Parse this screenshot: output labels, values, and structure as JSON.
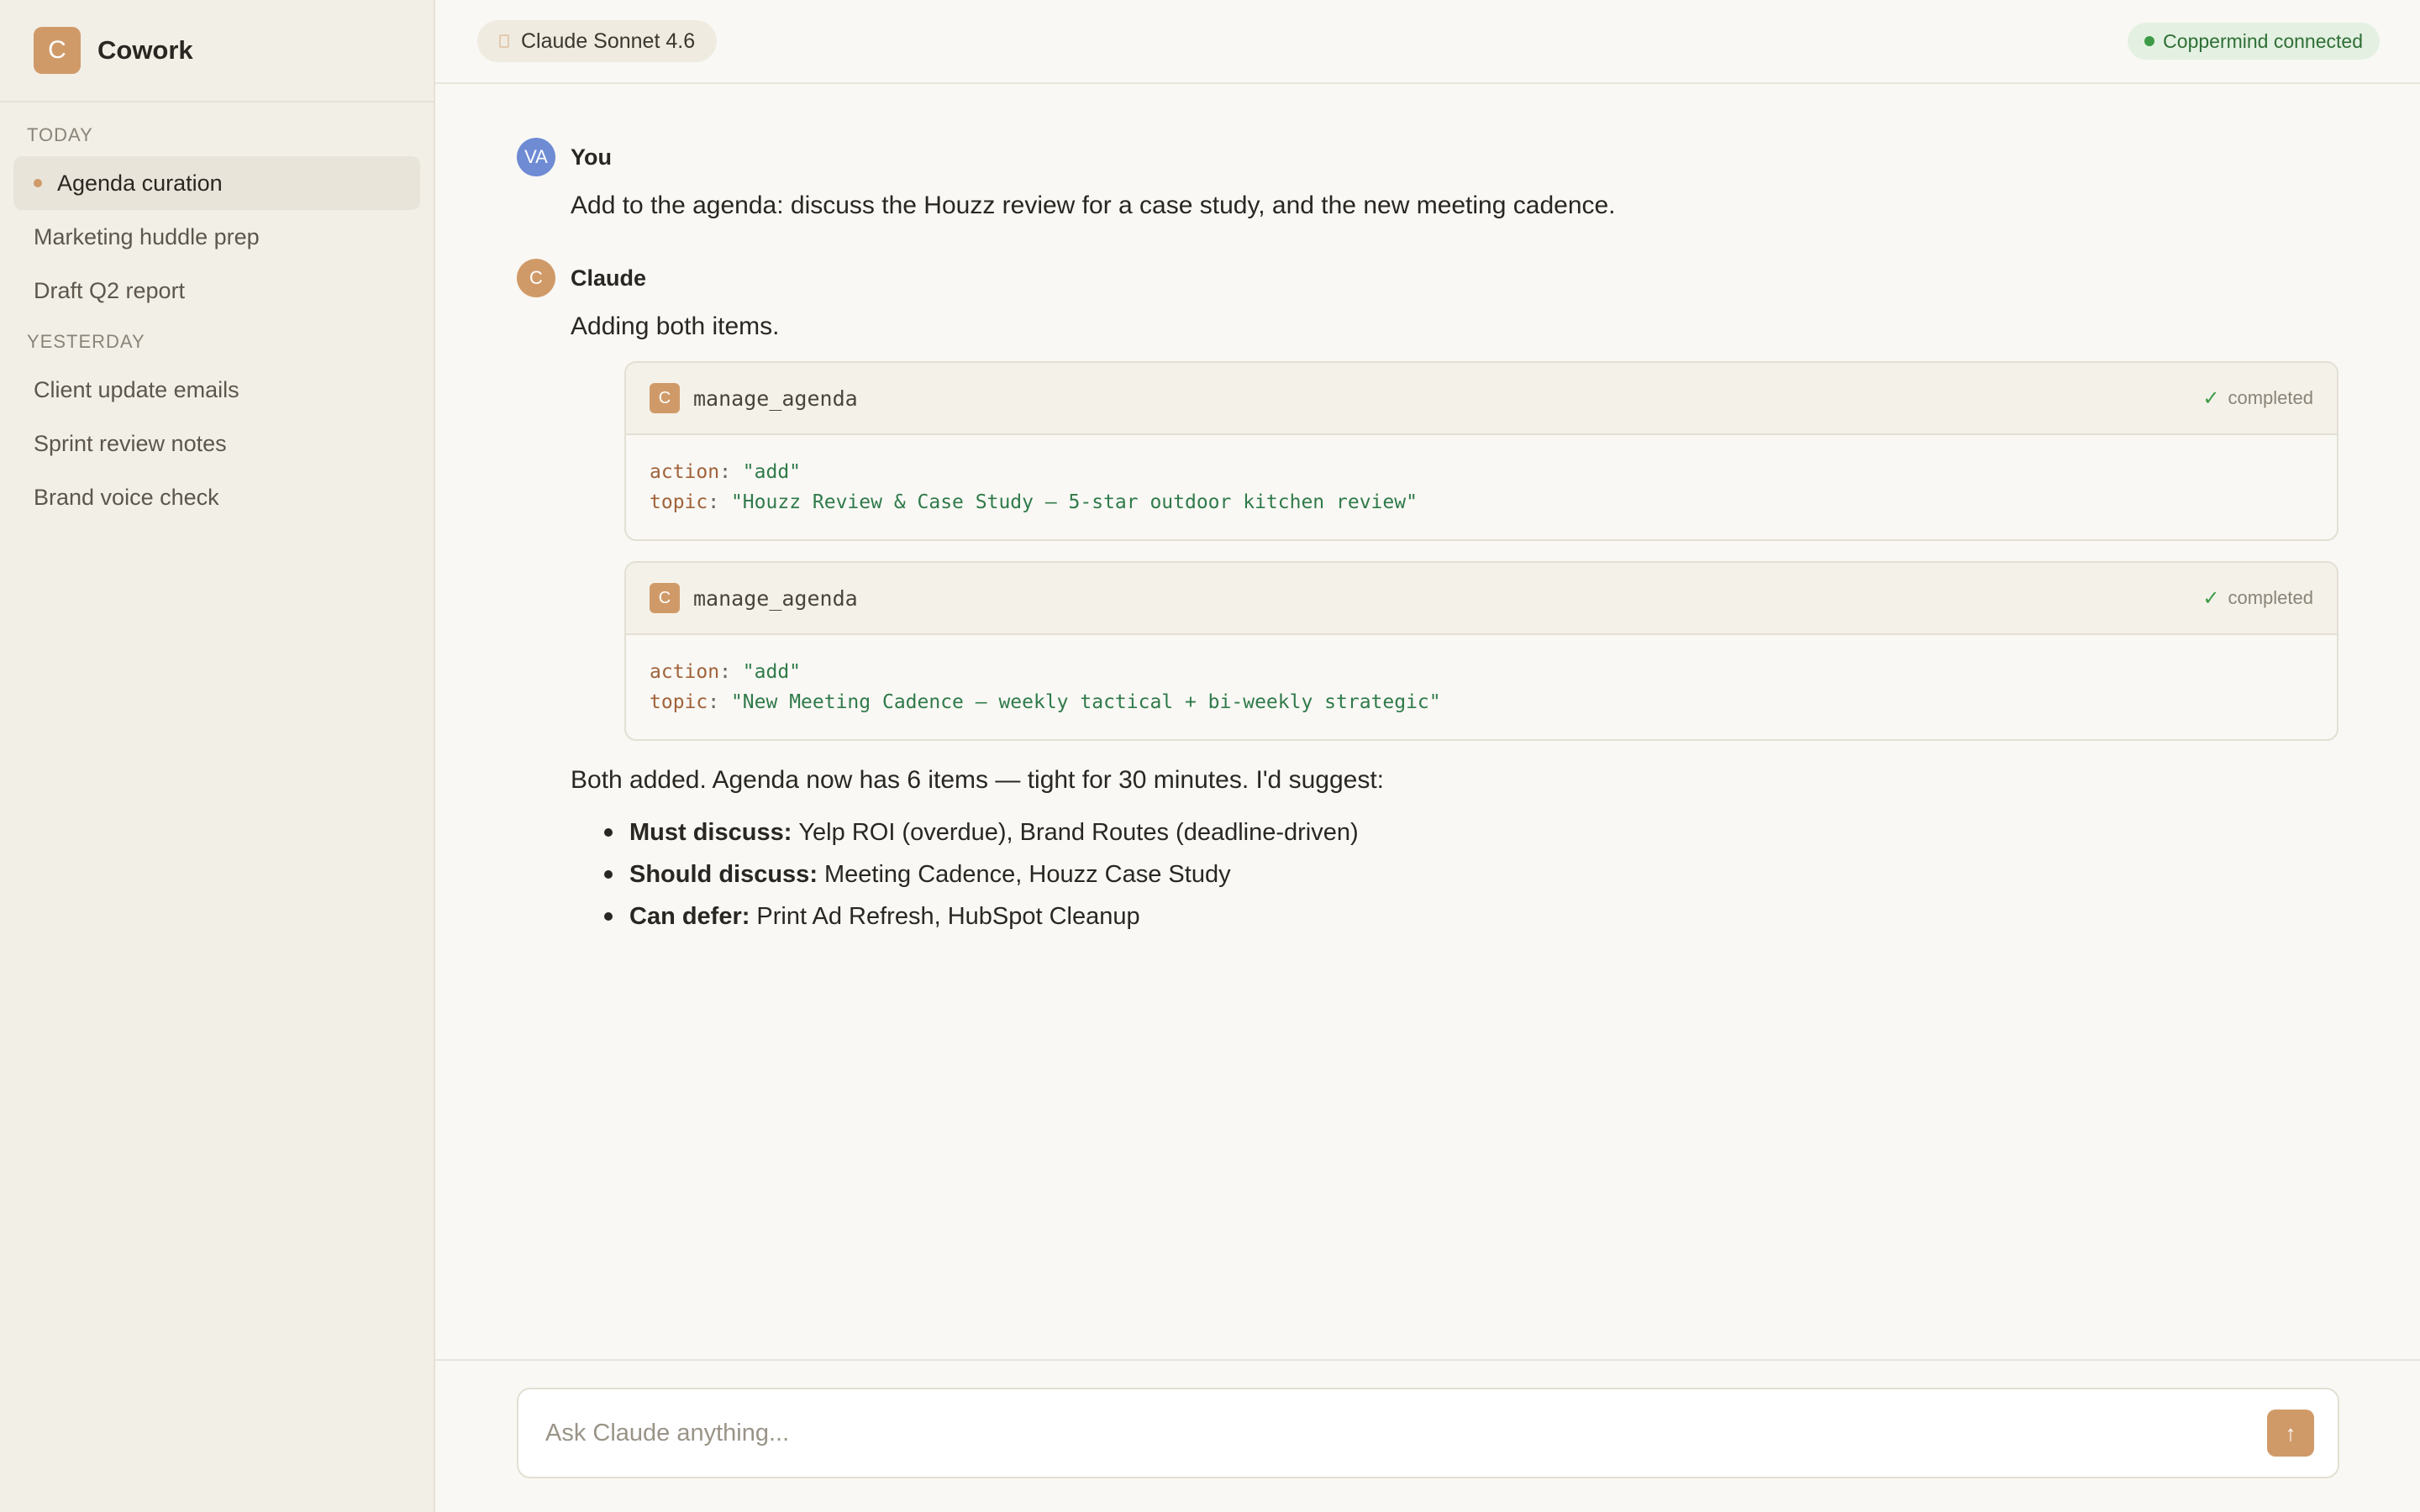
{
  "sidebar": {
    "brand": {
      "logo_letter": "C",
      "name": "Cowork"
    },
    "sections": [
      {
        "label": "TODAY",
        "items": [
          "Agenda curation",
          "Marketing huddle prep",
          "Draft Q2 report"
        ]
      },
      {
        "label": "YESTERDAY",
        "items": [
          "Client update emails",
          "Sprint review notes",
          "Brand voice check"
        ]
      }
    ],
    "active_item": "Agenda curation"
  },
  "topbar": {
    "model": "Claude Sonnet 4.6",
    "connection_status": "Coppermind connected"
  },
  "messages": [
    {
      "author": "You",
      "avatar": "VA",
      "text": "Add to the agenda: discuss the Houzz review for a case study, and the new meeting cadence."
    },
    {
      "author": "Claude",
      "avatar": "C",
      "intro": "Adding both items.",
      "tool_calls": [
        {
          "icon_letter": "C",
          "name": "manage_agenda",
          "status": "completed",
          "action_key": "action",
          "action_value": "\"add\"",
          "topic_key": "topic",
          "topic_value": "\"Houzz Review & Case Study — 5-star outdoor kitchen review\""
        },
        {
          "icon_letter": "C",
          "name": "manage_agenda",
          "status": "completed",
          "action_key": "action",
          "action_value": "\"add\"",
          "topic_key": "topic",
          "topic_value": "\"New Meeting Cadence — weekly tactical + bi-weekly strategic\""
        }
      ],
      "summary": "Both added. Agenda now has 6 items — tight for 30 minutes. I'd suggest:",
      "bullets": [
        {
          "label": "Must discuss:",
          "text": "Yelp ROI (overdue), Brand Routes (deadline-driven)"
        },
        {
          "label": "Should discuss:",
          "text": "Meeting Cadence, Houzz Case Study"
        },
        {
          "label": "Can defer:",
          "text": "Print Ad Refresh, HubSpot Cleanup"
        }
      ]
    }
  ],
  "composer": {
    "placeholder": "Ask Claude anything...",
    "send_icon": "arrow-up-icon"
  },
  "colors": {
    "accent": "#d09a68",
    "user_avatar": "#6e8bd4",
    "success": "#3d9a46"
  }
}
